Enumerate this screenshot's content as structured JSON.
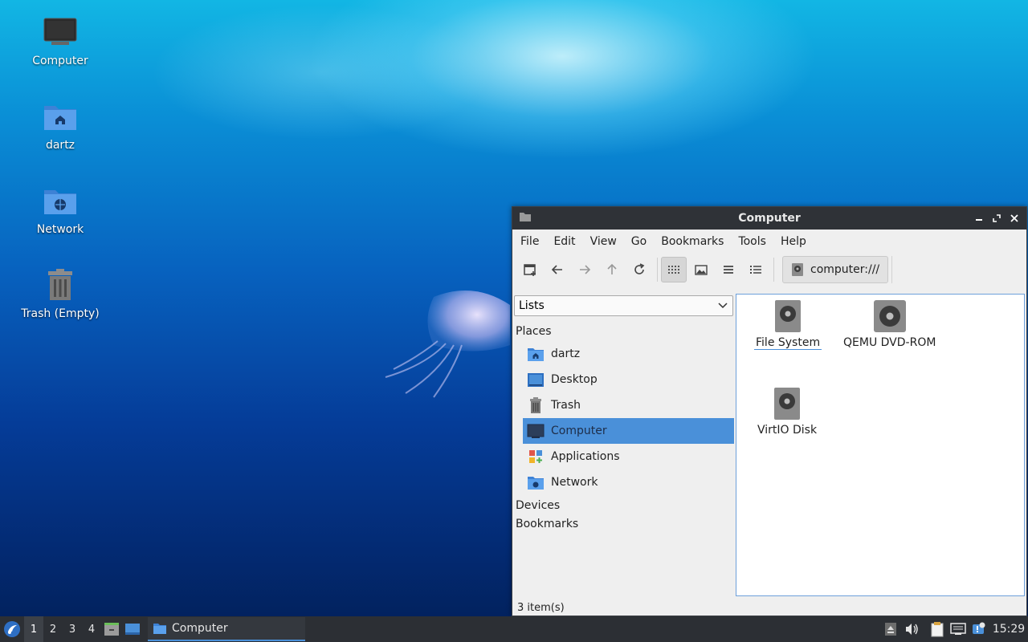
{
  "desktop": {
    "icons": [
      {
        "label": "Computer"
      },
      {
        "label": "dartz"
      },
      {
        "label": "Network"
      },
      {
        "label": "Trash (Empty)"
      }
    ]
  },
  "window": {
    "title": "Computer",
    "menu": [
      "File",
      "Edit",
      "View",
      "Go",
      "Bookmarks",
      "Tools",
      "Help"
    ],
    "location": "computer:///",
    "sidebar": {
      "mode": "Lists",
      "places_header": "Places",
      "places": [
        {
          "label": "dartz",
          "icon": "home-folder-icon"
        },
        {
          "label": "Desktop",
          "icon": "desktop-icon"
        },
        {
          "label": "Trash",
          "icon": "trash-icon"
        },
        {
          "label": "Computer",
          "icon": "computer-icon",
          "selected": true
        },
        {
          "label": "Applications",
          "icon": "applications-icon"
        },
        {
          "label": "Network",
          "icon": "network-folder-icon"
        }
      ],
      "devices_header": "Devices",
      "bookmarks_header": "Bookmarks"
    },
    "files": [
      {
        "label": "File System",
        "icon": "harddisk-icon"
      },
      {
        "label": "QEMU DVD-ROM",
        "icon": "optical-drive-icon"
      },
      {
        "label": "VirtIO Disk",
        "icon": "harddisk-icon"
      }
    ],
    "status": "3 item(s)"
  },
  "taskbar": {
    "workspaces": [
      "1",
      "2",
      "3",
      "4"
    ],
    "active_workspace": "1",
    "task_label": "Computer",
    "clock": "15:29"
  },
  "colors": {
    "accent": "#4a90d9",
    "titlebar": "#2f3237",
    "taskbar": "#2c2f34"
  }
}
